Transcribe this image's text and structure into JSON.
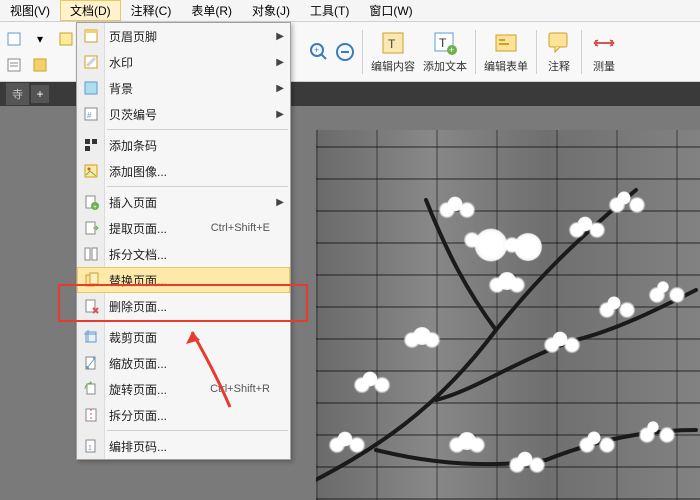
{
  "menubar": {
    "items": [
      {
        "label": "视图(V)"
      },
      {
        "label": "文档(D)",
        "active": true
      },
      {
        "label": "注释(C)"
      },
      {
        "label": "表单(R)"
      },
      {
        "label": "对象(J)"
      },
      {
        "label": "工具(T)"
      },
      {
        "label": "窗口(W)"
      }
    ]
  },
  "toolbar": {
    "edit_content": "编辑内容",
    "add_text": "添加文本",
    "edit_form": "编辑表单",
    "annotate": "注释",
    "measure": "测量"
  },
  "tabs": {
    "tab1": "寺"
  },
  "dropdown": {
    "items": [
      {
        "label": "页眉页脚",
        "submenu": true,
        "icon": "header-footer-icon"
      },
      {
        "label": "水印",
        "submenu": true,
        "icon": "watermark-icon"
      },
      {
        "label": "背景",
        "submenu": true,
        "icon": "background-icon"
      },
      {
        "label": "贝茨编号",
        "submenu": true,
        "icon": "bates-icon"
      },
      {
        "sep": true
      },
      {
        "label": "添加条码",
        "icon": "barcode-icon"
      },
      {
        "label": "添加图像...",
        "icon": "image-icon"
      },
      {
        "sep": true
      },
      {
        "label": "插入页面",
        "submenu": true,
        "icon": "insert-page-icon"
      },
      {
        "label": "提取页面...",
        "shortcut": "Ctrl+Shift+E",
        "icon": "extract-page-icon"
      },
      {
        "label": "拆分文档...",
        "icon": "split-doc-icon"
      },
      {
        "label": "替换页面...",
        "selected": true,
        "icon": "replace-page-icon"
      },
      {
        "label": "删除页面...",
        "icon": "delete-page-icon"
      },
      {
        "sep": true
      },
      {
        "label": "裁剪页面",
        "icon": "crop-page-icon"
      },
      {
        "label": "缩放页面...",
        "icon": "zoom-page-icon"
      },
      {
        "label": "旋转页面...",
        "shortcut": "Ctrl+Shift+R",
        "icon": "rotate-page-icon"
      },
      {
        "label": "拆分页面...",
        "icon": "split-page-icon"
      },
      {
        "sep": true
      },
      {
        "label": "编排页码...",
        "icon": "number-pages-icon"
      }
    ]
  }
}
